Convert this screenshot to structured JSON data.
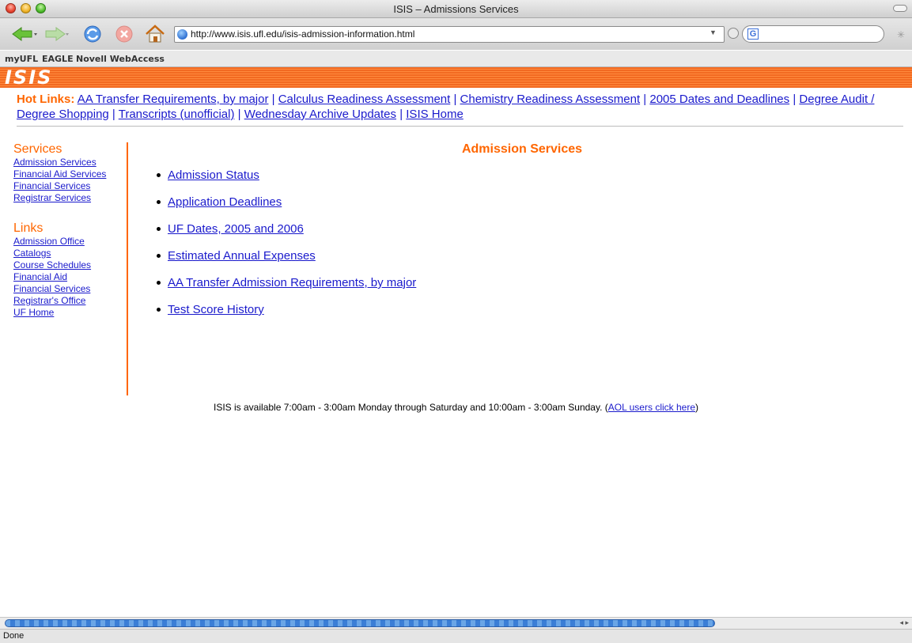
{
  "window": {
    "title": "ISIS – Admissions Services"
  },
  "navbar": {
    "url": "http://www.isis.ufl.edu/isis-admission-information.html",
    "search_engine_glyph": "G",
    "icons": [
      "back-icon",
      "forward-icon",
      "reload-icon",
      "stop-icon",
      "home-icon",
      "globe-icon",
      "go-icon",
      "google-icon",
      "spinner-icon"
    ]
  },
  "bookmarks": [
    "myUFL",
    "EAGLE",
    "Novell WebAccess"
  ],
  "banner": {
    "logo_text": "ISIS",
    "colors": {
      "orange": "#f26a21",
      "link": "#1a1acc"
    }
  },
  "hotlinks": {
    "label": "Hot Links:",
    "items": [
      "AA Transfer Requirements, by major",
      "Calculus Readiness Assessment",
      "Chemistry Readiness Assessment",
      "2005 Dates and Deadlines",
      "Degree Audit / Degree Shopping",
      "Transcripts (unofficial)",
      "Wednesday Archive Updates",
      "ISIS Home"
    ]
  },
  "sidebar": {
    "services_heading": "Services",
    "services": [
      "Admission Services",
      "Financial Aid Services",
      "Financial Services",
      "Registrar Services"
    ],
    "links_heading": "Links",
    "links": [
      "Admission Office",
      "Catalogs",
      "Course Schedules",
      "Financial Aid",
      "Financial Services",
      "Registrar's Office",
      "UF Home"
    ]
  },
  "main": {
    "title": "Admission Services",
    "items": [
      "Admission Status",
      "Application Deadlines",
      "UF Dates, 2005 and 2006",
      "Estimated Annual Expenses",
      "AA Transfer Admission Requirements, by major",
      "Test Score History"
    ]
  },
  "footer": {
    "availability": "ISIS is available 7:00am - 3:00am Monday through Saturday and 10:00am - 3:00am Sunday. (",
    "aol_link": "AOL users click here",
    "close_paren": ")"
  },
  "status": {
    "text": "Done"
  }
}
